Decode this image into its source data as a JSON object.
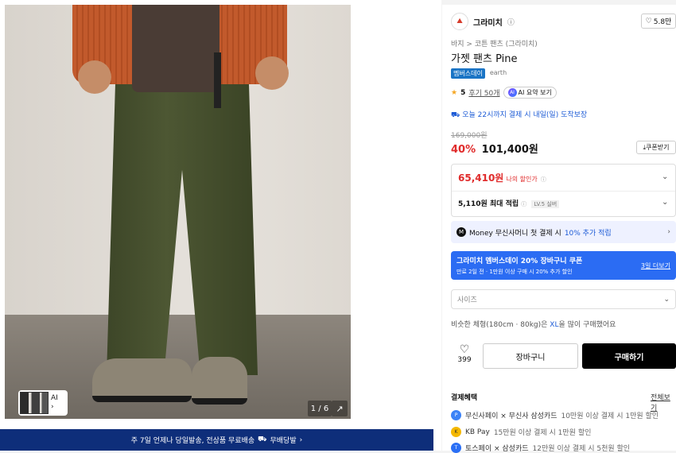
{
  "gallery": {
    "counter": "1 / 6",
    "thumb_label": "AI",
    "thumb_arrow": "›",
    "expand_icon": "↗"
  },
  "banner": {
    "text": "주 7일 언제나 당일발송, 전상품 무료배송",
    "badge": "무배당발",
    "arrow": "›"
  },
  "product": {
    "brand": "그라미치",
    "brand_info_icon": "ⓘ",
    "likes": "5.8만",
    "breadcrumb": "바지  >  코튼 팬츠 (그라미치)",
    "title": "가젯 팬츠 Pine",
    "tag_member": "멤버스데이",
    "tag_earth": "earth",
    "rating": "5",
    "reviews": "후기 50개",
    "ai_summary": "AI 요약 보기",
    "delivery": "오늘 22시까지 결제 시 내일(일) 도착보장",
    "original_price": "169,000원",
    "discount": "40%",
    "price": "101,400원",
    "coupon_button": "쿠폰받기"
  },
  "my_price": {
    "amount": "65,410원",
    "label": "나의 할인가",
    "points": "5,110원 최대 적립",
    "level": "LV.5 실버"
  },
  "money_banner": {
    "logo": "M",
    "text1": "Money 무신사머니 첫 결제 시",
    "highlight": "10% 추가 적립",
    "arrow": "›"
  },
  "member_coupon": {
    "title": "그라미치 멤버스데이 20% 장바구니 쿠폰",
    "subtitle": "만료 2일 전 · 1만원 이상 구매 시 20% 추가 할인",
    "more": "3일 더보기"
  },
  "size_select": {
    "placeholder": "사이즈",
    "arrow": "⌄"
  },
  "similar": {
    "prefix": "비슷한 체형(180cm · 80kg)은",
    "size": "XL",
    "suffix": "을 많이 구매했어요"
  },
  "actions": {
    "like_count": "399",
    "cart": "장바구니",
    "buy": "구매하기"
  },
  "benefits": {
    "header": "결제혜택",
    "view_all": "전체보기",
    "items": [
      {
        "name": "무신사페이 × 무신사 삼성카드",
        "desc": "10만원 이상 결제 시 1만원 할인",
        "color": "#3b82f6"
      },
      {
        "name": "KB Pay",
        "desc": "15만원 이상 결제 시 1만원 할인",
        "color": "#f5b800"
      },
      {
        "name": "토스페이 × 삼성카드",
        "desc": "12만원 이상 결제 시 5천원 할인",
        "color": "#2a6ff5"
      }
    ]
  }
}
